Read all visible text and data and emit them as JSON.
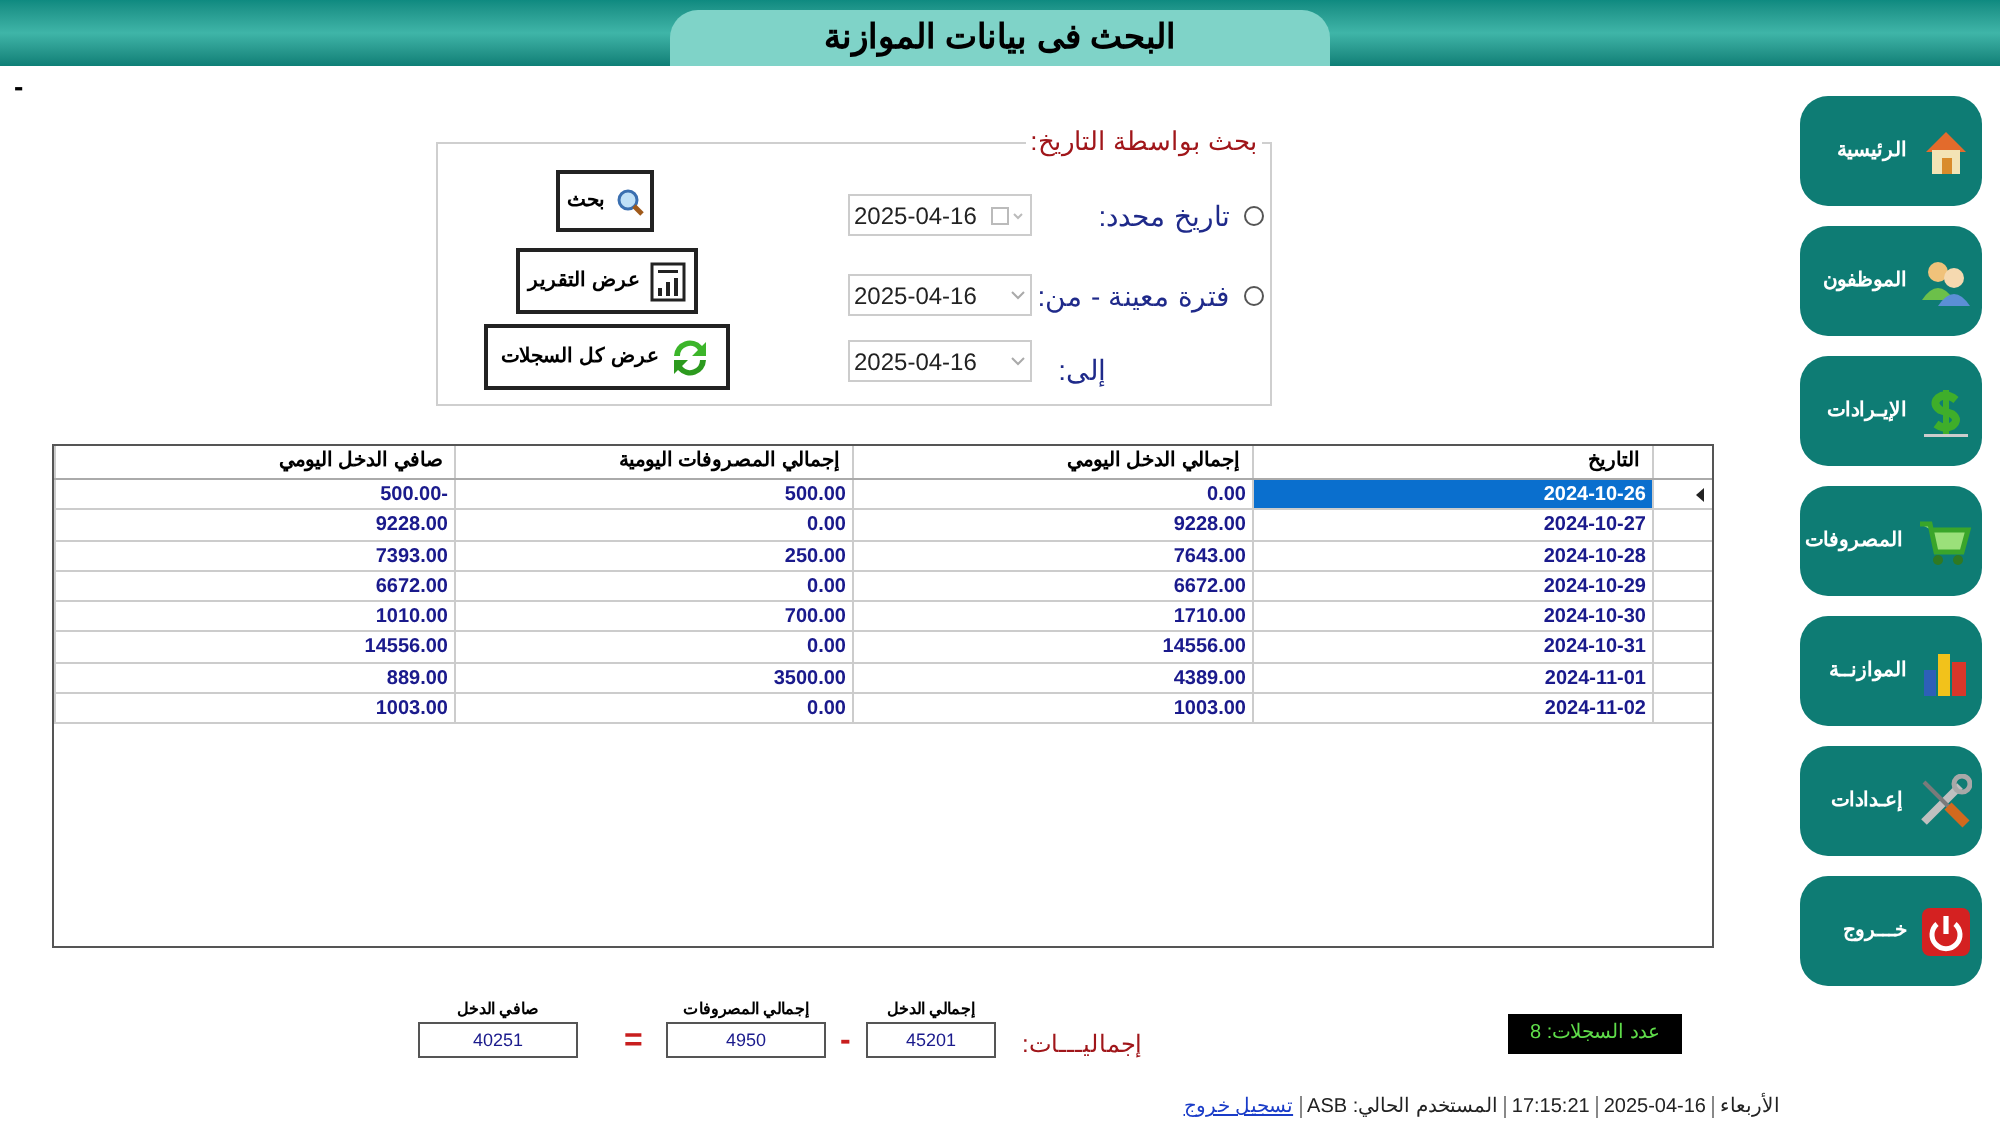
{
  "header": {
    "title": "البحث فى بيانات الموازنة"
  },
  "corner_mark": "-",
  "search_group": {
    "title": "بحث بواسطة التاريخ:",
    "options": [
      {
        "label": "تاريخ محدد:",
        "selected": false,
        "date": "2025-04-16",
        "kind": "calendar"
      },
      {
        "label": "فترة معينة - من:",
        "selected": false,
        "date": "2025-04-16",
        "kind": "dropdown"
      }
    ],
    "to_label": "إلى:",
    "to_date": "2025-04-16",
    "buttons": [
      {
        "label": "بحث",
        "kind": "search"
      },
      {
        "label": "عرض التقرير",
        "kind": "report"
      },
      {
        "label": "عرض كل السجلات",
        "kind": "refresh"
      }
    ]
  },
  "table": {
    "columns": [
      "التاريخ",
      "إجمالي الدخل اليومي",
      "إجمالي المصروفات اليومية",
      "صافي الدخل اليومي"
    ],
    "rows": [
      {
        "selected": true,
        "cells": [
          "2024-10-26",
          "0.00",
          "500.00",
          "500.00-"
        ]
      },
      {
        "selected": false,
        "cells": [
          "2024-10-27",
          "9228.00",
          "0.00",
          "9228.00"
        ]
      },
      {
        "selected": false,
        "cells": [
          "2024-10-28",
          "7643.00",
          "250.00",
          "7393.00"
        ]
      },
      {
        "selected": false,
        "cells": [
          "2024-10-29",
          "6672.00",
          "0.00",
          "6672.00"
        ]
      },
      {
        "selected": false,
        "cells": [
          "2024-10-30",
          "1710.00",
          "700.00",
          "1010.00"
        ]
      },
      {
        "selected": false,
        "cells": [
          "2024-10-31",
          "14556.00",
          "0.00",
          "14556.00"
        ]
      },
      {
        "selected": false,
        "cells": [
          "2024-11-01",
          "4389.00",
          "3500.00",
          "889.00"
        ]
      },
      {
        "selected": false,
        "cells": [
          "2024-11-02",
          "1003.00",
          "0.00",
          "1003.00"
        ]
      }
    ]
  },
  "totals": {
    "label": "إجماليـــات:",
    "fields": [
      {
        "caption": "إجمالي الدخل",
        "value": "45201"
      },
      {
        "caption": "إجمالي المصروفات",
        "value": "4950"
      },
      {
        "caption": "صافي الدخل",
        "value": "40251"
      }
    ],
    "operators": [
      "-",
      "="
    ]
  },
  "record_count": "عدد السجلات: 8",
  "status_bar": {
    "day": "الأربعاء",
    "date": "2025-04-16",
    "time": "17:15:21",
    "user": "المستخدم الحالي: ASB",
    "logout": "تسجيل خروج"
  },
  "sidebar": {
    "items": [
      {
        "label": "الرئيسية",
        "kind": "home"
      },
      {
        "label": "الموظفون",
        "kind": "people"
      },
      {
        "label": "الإيـرادات",
        "kind": "dollar"
      },
      {
        "label": "المصروفات",
        "kind": "cart"
      },
      {
        "label": "الموازنــة",
        "kind": "chart"
      },
      {
        "label": "إعـدادات",
        "kind": "tools"
      },
      {
        "label": "خـــروج",
        "kind": "power"
      }
    ]
  }
}
